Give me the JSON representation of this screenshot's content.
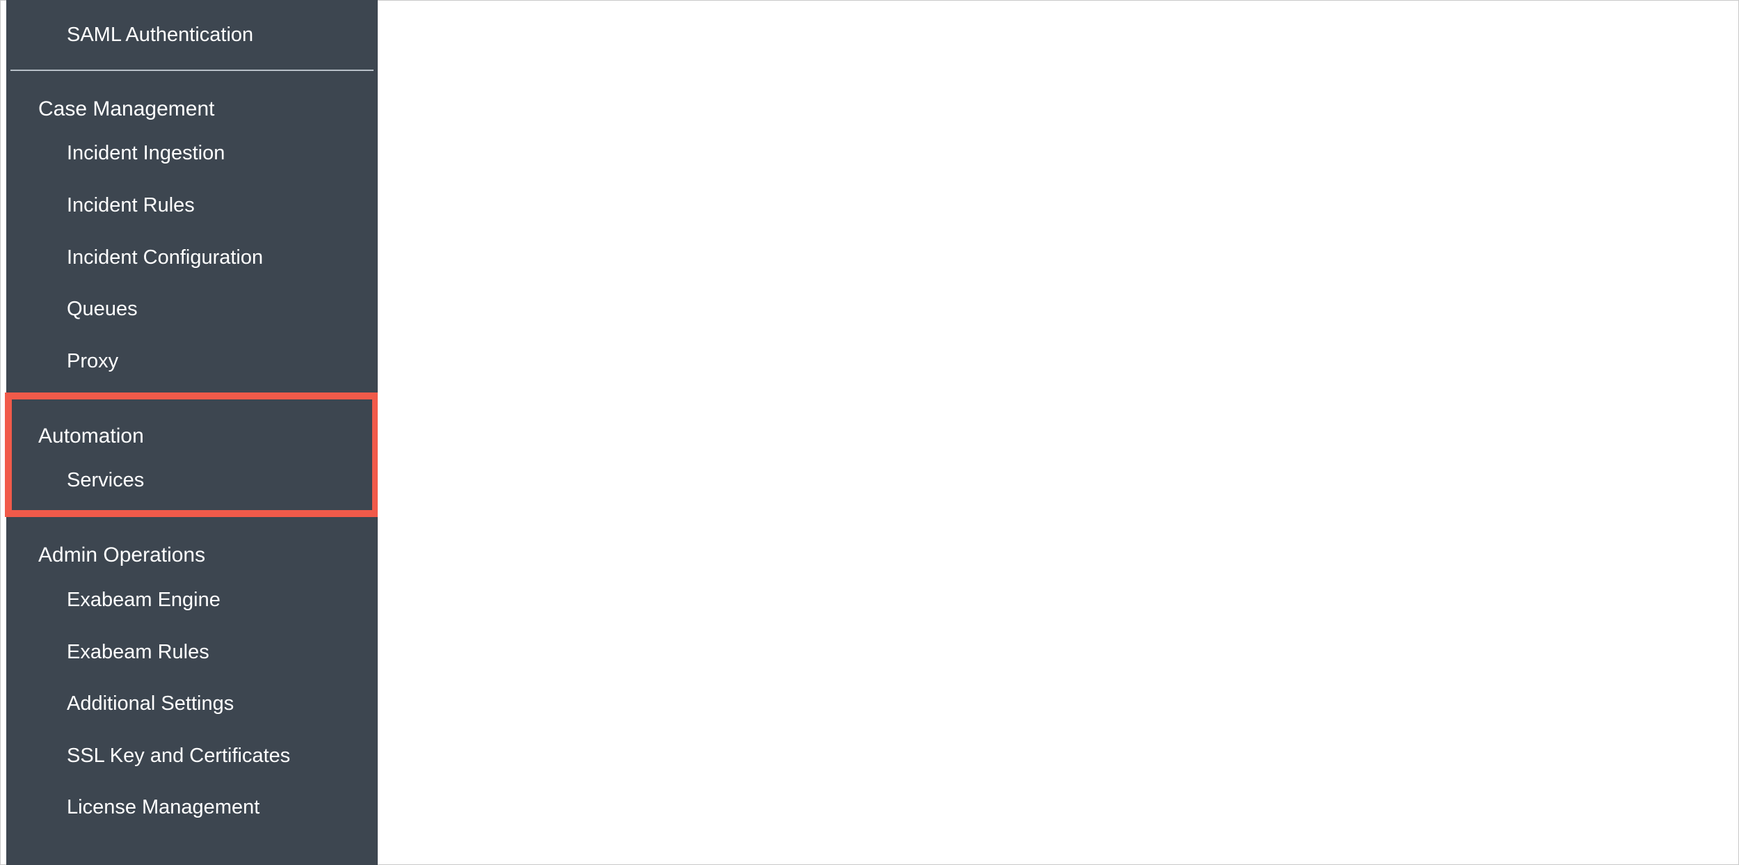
{
  "sidebar": {
    "top_item": "SAML Authentication",
    "sections": [
      {
        "heading": "Case Management",
        "items": [
          "Incident Ingestion",
          "Incident Rules",
          "Incident Configuration",
          "Queues",
          "Proxy"
        ]
      },
      {
        "heading": "Automation",
        "items": [
          "Services"
        ],
        "highlighted": true
      },
      {
        "heading": "Admin Operations",
        "items": [
          "Exabeam Engine",
          "Exabeam Rules",
          "Additional Settings",
          "SSL Key and Certificates",
          "License Management"
        ]
      }
    ]
  },
  "colors": {
    "sidebar_bg": "#3d4650",
    "highlight": "#f15a4a",
    "text": "#ffffff"
  }
}
